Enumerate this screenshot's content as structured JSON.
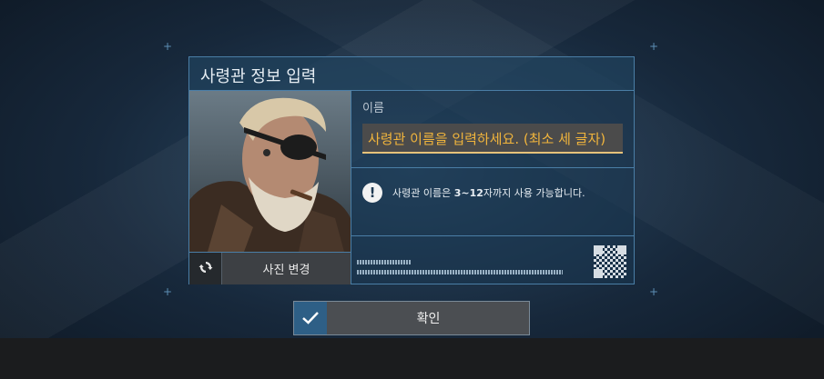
{
  "dialog": {
    "title": "사령관 정보 입력",
    "name_label": "이름",
    "name_input": {
      "value": "",
      "placeholder": "사령관 이름을 입력하세요. (최소 세 글자)"
    },
    "info_text_prefix": "사령관 이름은 ",
    "info_text_bold": "3~12",
    "info_text_suffix": "자까지 사용 가능합니다.",
    "change_photo_label": "사진 변경",
    "confirm_label": "확인"
  },
  "colors": {
    "accent": "#4a7ea6",
    "placeholder": "#f0b43c",
    "confirm_check_bg": "#2e5f86"
  },
  "icons": {
    "refresh": "refresh-icon",
    "alert": "alert-icon",
    "check": "check-icon",
    "qr": "qr-code-icon"
  }
}
